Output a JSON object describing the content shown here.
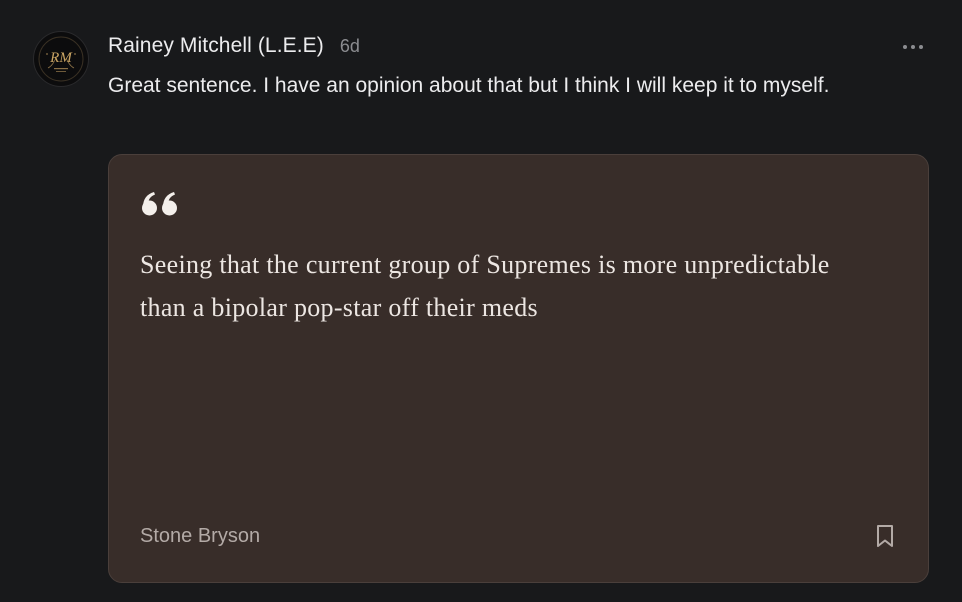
{
  "comment": {
    "author": "Rainey Mitchell (L.E.E)",
    "timestamp": "6d",
    "body": "Great sentence. I have an opinion about that but I think I will keep it to myself.",
    "avatar_monogram": "RM",
    "avatar_icon": "monogram-logo-icon",
    "more_icon": "more-horizontal-icon"
  },
  "quote_card": {
    "quote_icon": "quote-mark-icon",
    "text": "Seeing that the current group of Supremes is more unpredictable than a bipolar pop-star off their meds",
    "author": "Stone Bryson",
    "bookmark_icon": "bookmark-icon"
  },
  "colors": {
    "background": "#18191b",
    "card_background": "#382d29",
    "card_border": "#4a3f3b",
    "muted_text": "#8b8c90",
    "avatar_gold": "#c9a463"
  }
}
